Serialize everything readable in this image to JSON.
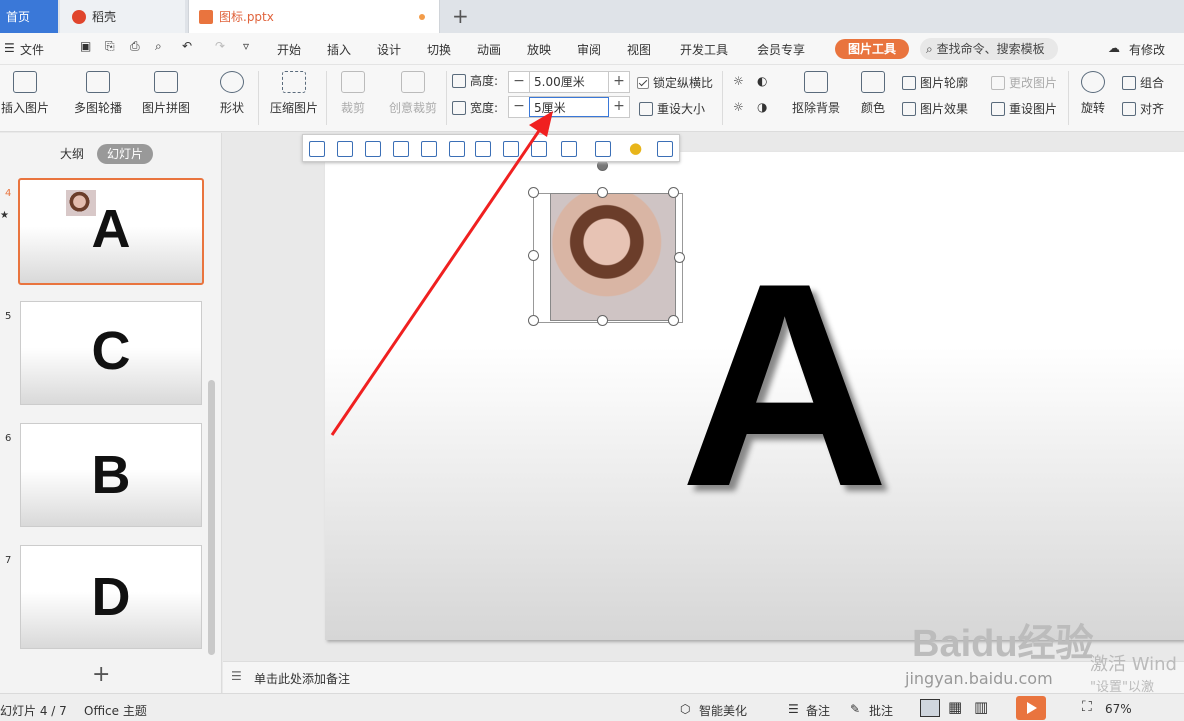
{
  "tabs": {
    "home": "首页",
    "daoke": "稻壳",
    "doc": "图标.pptx",
    "new": "+"
  },
  "menu": {
    "file": "文件",
    "items": [
      "开始",
      "插入",
      "设计",
      "切换",
      "动画",
      "放映",
      "审阅",
      "视图",
      "开发工具",
      "会员专享"
    ],
    "pic_tools": "图片工具",
    "search": "查找命令、搜索模板",
    "modify": "有修改"
  },
  "ribbon": {
    "insert_pic": "插入图片",
    "multi_outline": "多图轮播",
    "pic_collage": "图片拼图",
    "shape": "形状",
    "compress": "压缩图片",
    "crop": "裁剪",
    "creative_crop": "创意裁剪",
    "height_label": "高度:",
    "height_value": "5.00厘米",
    "width_label": "宽度:",
    "width_value": "5厘米",
    "lock_ratio": "锁定纵横比",
    "reset_size": "重设大小",
    "remove_bg": "抠除背景",
    "color": "颜色",
    "pic_outline": "图片轮廓",
    "pic_effect": "图片效果",
    "change_pic": "更改图片",
    "reset_pic": "重设图片",
    "rotate": "旋转",
    "group": "组合",
    "align": "对齐"
  },
  "panel": {
    "outline_tab": "大纲",
    "slides_tab": "幻灯片",
    "slides": [
      {
        "num": "4",
        "letter": "A"
      },
      {
        "num": "5",
        "letter": "C"
      },
      {
        "num": "6",
        "letter": "B"
      },
      {
        "num": "7",
        "letter": "D"
      }
    ],
    "add": "+"
  },
  "canvas": {
    "big_letter": "A"
  },
  "notes": {
    "placeholder": "单击此处添加备注"
  },
  "status": {
    "slide_info": "幻灯片 4 / 7",
    "theme": "Office 主题",
    "beautify": "智能美化",
    "notes": "备注",
    "comment": "批注",
    "zoom": "67%"
  },
  "watermark": {
    "activate": "激活 Wind",
    "settings": "\"设置\"以激",
    "brand": "Baidu经验",
    "url": "jingyan.baidu.com"
  },
  "colors": {
    "accent": "#e9743e",
    "home_tab": "#3a78d8",
    "arrow": "#f02020"
  }
}
